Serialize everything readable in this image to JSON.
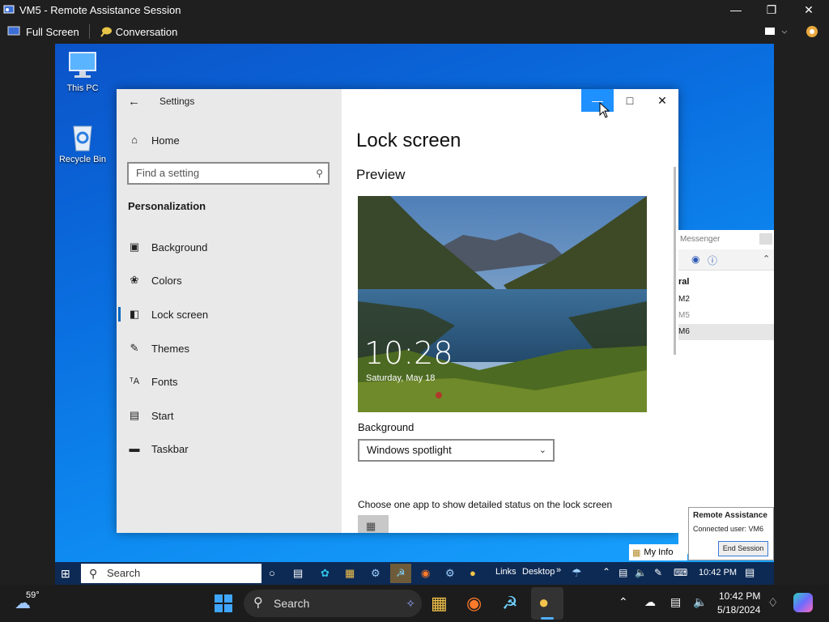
{
  "window": {
    "title": "VM5 - Remote Assistance Session"
  },
  "toolbar": {
    "full_screen": "Full Screen",
    "conversation": "Conversation"
  },
  "desktop": {
    "icons": [
      {
        "label": "This PC"
      },
      {
        "label": "Recycle Bin"
      }
    ]
  },
  "settings": {
    "app_title": "Settings",
    "home": "Home",
    "search_placeholder": "Find a setting",
    "section": "Personalization",
    "nav": [
      {
        "label": "Background",
        "icon": "image-icon"
      },
      {
        "label": "Colors",
        "icon": "palette-icon"
      },
      {
        "label": "Lock screen",
        "icon": "lock-screen-icon",
        "active": true
      },
      {
        "label": "Themes",
        "icon": "brush-icon"
      },
      {
        "label": "Fonts",
        "icon": "font-icon"
      },
      {
        "label": "Start",
        "icon": "start-icon"
      },
      {
        "label": "Taskbar",
        "icon": "taskbar-icon"
      }
    ],
    "page_title": "Lock screen",
    "preview_heading": "Preview",
    "preview_time": "10:28",
    "preview_date": "Saturday, May 18",
    "background_label": "Background",
    "background_value": "Windows spotlight",
    "status_app_label": "Choose one app to show detailed status on the lock screen"
  },
  "messenger": {
    "title": "Messenger",
    "group": "ral",
    "contacts": [
      "M2",
      "M5",
      "M6"
    ]
  },
  "ra_panel": {
    "title": "Remote Assistance",
    "connected": "Connected user: VM6",
    "end_button": "End Session"
  },
  "my_info": "My Info",
  "inner_taskbar": {
    "search": "Search",
    "links": "Links",
    "desktop": "Desktop",
    "time": "10:42 PM"
  },
  "outer_taskbar": {
    "weather": "59°",
    "search": "Search",
    "time": "10:42 PM",
    "date": "5/18/2024"
  },
  "colors": {
    "accent": "#0078d7",
    "highlight": "#1e90ff"
  }
}
